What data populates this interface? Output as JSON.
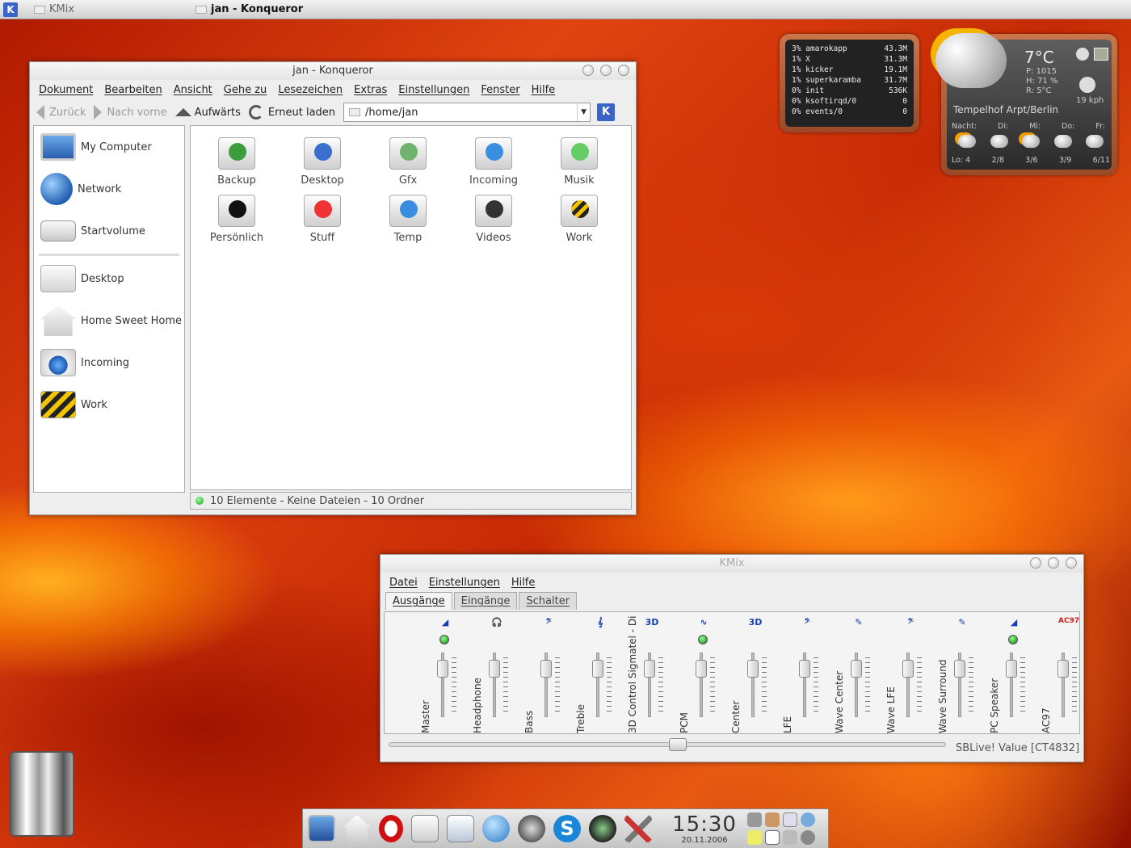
{
  "taskbar": {
    "kmix_label": "KMix",
    "konq_label": "jan - Konqueror"
  },
  "konqueror": {
    "title": "jan - Konqueror",
    "menu": [
      "Dokument",
      "Bearbeiten",
      "Ansicht",
      "Gehe zu",
      "Lesezeichen",
      "Extras",
      "Einstellungen",
      "Fenster",
      "Hilfe"
    ],
    "toolbar": {
      "back": "Zurück",
      "forward": "Nach vorne",
      "up": "Aufwärts",
      "reload": "Erneut laden"
    },
    "url": "/home/jan",
    "sidebar": [
      "My Computer",
      "Network",
      "Startvolume",
      "Desktop",
      "Home Sweet Home",
      "Incoming",
      "Work"
    ],
    "files": [
      "Backup",
      "Desktop",
      "Gfx",
      "Incoming",
      "Musik",
      "Persönlich",
      "Stuff",
      "Temp",
      "Videos",
      "Work"
    ],
    "status": "10 Elemente - Keine Dateien - 10 Ordner"
  },
  "processes": [
    {
      "pct": "3%",
      "name": "amarokapp",
      "mem": "43.3M"
    },
    {
      "pct": "1%",
      "name": "X",
      "mem": "31.3M"
    },
    {
      "pct": "1%",
      "name": "kicker",
      "mem": "19.1M"
    },
    {
      "pct": "1%",
      "name": "superkaramba",
      "mem": "31.7M"
    },
    {
      "pct": "0%",
      "name": "init",
      "mem": "536K"
    },
    {
      "pct": "0%",
      "name": "ksoftirqd/0",
      "mem": "0"
    },
    {
      "pct": "0%",
      "name": "events/0",
      "mem": "0"
    }
  ],
  "weather": {
    "temp": "7°C",
    "pressure": "P: 1015",
    "humidity": "H: 71 %",
    "real": "R: 5°C",
    "wind": "19 kph",
    "location": "Tempelhof Arpt/Berlin",
    "days": [
      "Nacht:",
      "Di:",
      "Mi:",
      "Do:",
      "Fr:"
    ],
    "lows": [
      "Lo: 4",
      "2/8",
      "3/6",
      "3/9",
      "6/11"
    ]
  },
  "kmix": {
    "title": "KMix",
    "menu": [
      "Datei",
      "Einstellungen",
      "Hilfe"
    ],
    "tabs": [
      "Ausgänge",
      "Eingänge",
      "Schalter"
    ],
    "channels": [
      {
        "name": "Master",
        "icon": "◢",
        "led": true,
        "level": 0.82
      },
      {
        "name": "Headphone",
        "icon": "🎧",
        "led": false,
        "level": 0.82
      },
      {
        "name": "Bass",
        "icon": "𝄢",
        "led": false,
        "level": 0.82
      },
      {
        "name": "Treble",
        "icon": "𝄞",
        "led": false,
        "level": 0.82
      },
      {
        "name": "3D Control Sigmatel - Di",
        "icon": "3D",
        "led": false,
        "level": 0.82
      },
      {
        "name": "PCM",
        "icon": "∿",
        "led": true,
        "level": 0.82
      },
      {
        "name": "Center",
        "icon": "3D",
        "led": false,
        "level": 0.82
      },
      {
        "name": "LFE",
        "icon": "𝄢",
        "led": false,
        "level": 0.82
      },
      {
        "name": "Wave Center",
        "icon": "✎",
        "led": false,
        "level": 0.82
      },
      {
        "name": "Wave LFE",
        "icon": "𝄢",
        "led": false,
        "level": 0.82
      },
      {
        "name": "Wave Surround",
        "icon": "✎",
        "led": false,
        "level": 0.82
      },
      {
        "name": "PC Speaker",
        "icon": "◢",
        "led": true,
        "level": 0.82
      },
      {
        "name": "AC97",
        "icon": "AC97",
        "led": false,
        "level": 0.82
      }
    ],
    "device": "SBLive! Value [CT4832]"
  },
  "clock": {
    "time": "15:30",
    "date": "20.11.2006"
  }
}
